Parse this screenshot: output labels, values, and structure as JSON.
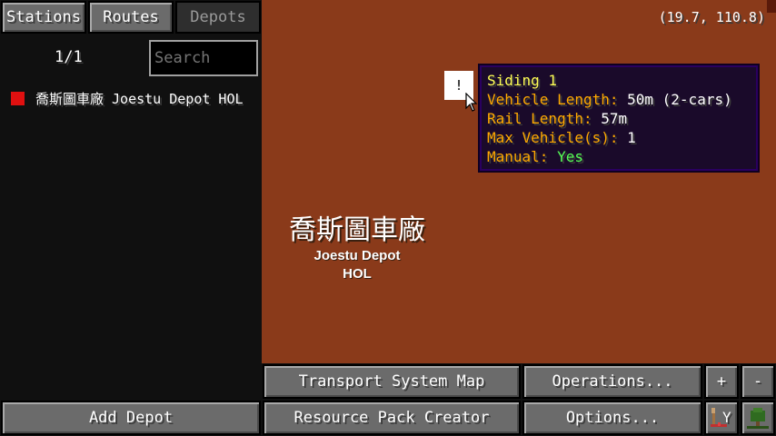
{
  "tabs": [
    {
      "label": "Stations",
      "active": false
    },
    {
      "label": "Routes",
      "active": false
    },
    {
      "label": "Depots",
      "active": true
    }
  ],
  "list": {
    "page": "1/1",
    "search_placeholder": "Search",
    "items": [
      {
        "label": "喬斯圖車廠 Joestu Depot  HOL",
        "color": "#e01010"
      }
    ]
  },
  "map": {
    "coords": "(19.7, 110.8)",
    "depot_name_zh": "喬斯圖車廠",
    "depot_name_en": "Joestu Depot",
    "depot_code": "HOL",
    "siding_marker_glyph": "!",
    "tooltip": {
      "title": "Siding 1",
      "vehicle_length_label": "Vehicle Length: ",
      "vehicle_length_value": "50m (2-cars)",
      "rail_length_label": "Rail Length: ",
      "rail_length_value": "57m",
      "max_vehicles_label": "Max Vehicle(s): ",
      "max_vehicles_value": "1",
      "manual_label": "Manual: ",
      "manual_value": "Yes"
    }
  },
  "buttons": {
    "transport_map": "Transport System Map",
    "operations": "Operations...",
    "zoom_in": "+",
    "zoom_out": "-",
    "add_depot": "Add Depot",
    "resource_pack": "Resource Pack Creator",
    "options": "Options...",
    "icon_rail_y": "Y"
  },
  "colors": {
    "map_background": "#8a3a1a",
    "tooltip_title": "#ffff55",
    "tooltip_label": "#ffaa00",
    "tooltip_yes": "#55ff55"
  }
}
